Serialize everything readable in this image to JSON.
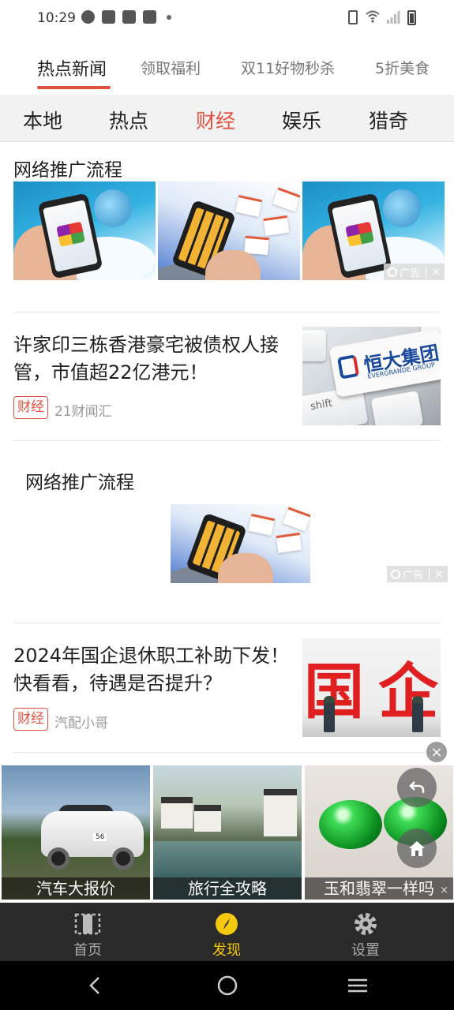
{
  "status_bar": {
    "time": "10:29"
  },
  "top_tabs": [
    {
      "label": "热点新闻",
      "active": true
    },
    {
      "label": "领取福利",
      "active": false
    },
    {
      "label": "双11好物秒杀",
      "active": false
    },
    {
      "label": "5折美食",
      "active": false
    }
  ],
  "categories": [
    {
      "label": "本地",
      "active": false
    },
    {
      "label": "热点",
      "active": false
    },
    {
      "label": "财经",
      "active": true
    },
    {
      "label": "娱乐",
      "active": false
    },
    {
      "label": "猎奇",
      "active": false
    }
  ],
  "ad_block_1": {
    "title": "网络推广流程",
    "badge": "广告",
    "close": "×"
  },
  "news": [
    {
      "title": "许家印三栋香港豪宅被债权人接管，市值超22亿港元！",
      "tag": "财经",
      "source": "21财闻汇",
      "thumb": {
        "logo_cn": "恒大集团",
        "logo_en": "EVERGRANDE GROUP",
        "key": "shift"
      }
    },
    {
      "title": "2024年国企退休职工补助下发！快看看，待遇是否提升？",
      "tag": "财经",
      "source": "汽配小哥",
      "thumb": {
        "glyph_left": "国",
        "glyph_right": "企"
      }
    }
  ],
  "ad_block_2": {
    "title": "网络推广流程",
    "badge": "广告",
    "close": "×"
  },
  "float_ad": {
    "tiles": [
      {
        "label": "汽车大报价",
        "plate": "56"
      },
      {
        "label": "旅行全攻略"
      },
      {
        "label": "玉和翡翠一样吗"
      }
    ],
    "close": "×",
    "badge_close": "×"
  },
  "bottom_nav": [
    {
      "label": "首页",
      "icon": "home-frame-icon",
      "active": false
    },
    {
      "label": "发现",
      "icon": "compass-icon",
      "active": true
    },
    {
      "label": "设置",
      "icon": "gear-icon",
      "active": false
    }
  ],
  "colors": {
    "accent": "#e4503f",
    "nav_active": "#f6c90e",
    "nav_bg": "#2a2a2a"
  }
}
